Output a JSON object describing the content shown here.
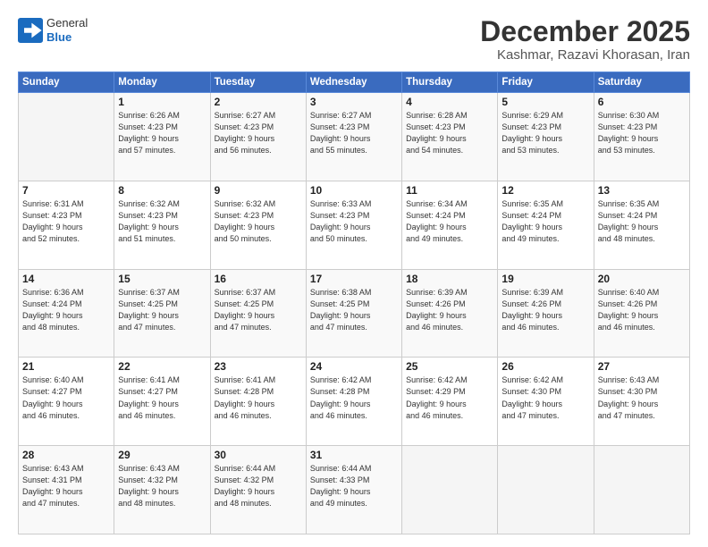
{
  "header": {
    "logo": {
      "general": "General",
      "blue": "Blue"
    },
    "title": "December 2025",
    "location": "Kashmar, Razavi Khorasan, Iran"
  },
  "calendar": {
    "days_of_week": [
      "Sunday",
      "Monday",
      "Tuesday",
      "Wednesday",
      "Thursday",
      "Friday",
      "Saturday"
    ],
    "weeks": [
      [
        {
          "day": "",
          "info": ""
        },
        {
          "day": "1",
          "info": "Sunrise: 6:26 AM\nSunset: 4:23 PM\nDaylight: 9 hours\nand 57 minutes."
        },
        {
          "day": "2",
          "info": "Sunrise: 6:27 AM\nSunset: 4:23 PM\nDaylight: 9 hours\nand 56 minutes."
        },
        {
          "day": "3",
          "info": "Sunrise: 6:27 AM\nSunset: 4:23 PM\nDaylight: 9 hours\nand 55 minutes."
        },
        {
          "day": "4",
          "info": "Sunrise: 6:28 AM\nSunset: 4:23 PM\nDaylight: 9 hours\nand 54 minutes."
        },
        {
          "day": "5",
          "info": "Sunrise: 6:29 AM\nSunset: 4:23 PM\nDaylight: 9 hours\nand 53 minutes."
        },
        {
          "day": "6",
          "info": "Sunrise: 6:30 AM\nSunset: 4:23 PM\nDaylight: 9 hours\nand 53 minutes."
        }
      ],
      [
        {
          "day": "7",
          "info": "Sunrise: 6:31 AM\nSunset: 4:23 PM\nDaylight: 9 hours\nand 52 minutes."
        },
        {
          "day": "8",
          "info": "Sunrise: 6:32 AM\nSunset: 4:23 PM\nDaylight: 9 hours\nand 51 minutes."
        },
        {
          "day": "9",
          "info": "Sunrise: 6:32 AM\nSunset: 4:23 PM\nDaylight: 9 hours\nand 50 minutes."
        },
        {
          "day": "10",
          "info": "Sunrise: 6:33 AM\nSunset: 4:23 PM\nDaylight: 9 hours\nand 50 minutes."
        },
        {
          "day": "11",
          "info": "Sunrise: 6:34 AM\nSunset: 4:24 PM\nDaylight: 9 hours\nand 49 minutes."
        },
        {
          "day": "12",
          "info": "Sunrise: 6:35 AM\nSunset: 4:24 PM\nDaylight: 9 hours\nand 49 minutes."
        },
        {
          "day": "13",
          "info": "Sunrise: 6:35 AM\nSunset: 4:24 PM\nDaylight: 9 hours\nand 48 minutes."
        }
      ],
      [
        {
          "day": "14",
          "info": "Sunrise: 6:36 AM\nSunset: 4:24 PM\nDaylight: 9 hours\nand 48 minutes."
        },
        {
          "day": "15",
          "info": "Sunrise: 6:37 AM\nSunset: 4:25 PM\nDaylight: 9 hours\nand 47 minutes."
        },
        {
          "day": "16",
          "info": "Sunrise: 6:37 AM\nSunset: 4:25 PM\nDaylight: 9 hours\nand 47 minutes."
        },
        {
          "day": "17",
          "info": "Sunrise: 6:38 AM\nSunset: 4:25 PM\nDaylight: 9 hours\nand 47 minutes."
        },
        {
          "day": "18",
          "info": "Sunrise: 6:39 AM\nSunset: 4:26 PM\nDaylight: 9 hours\nand 46 minutes."
        },
        {
          "day": "19",
          "info": "Sunrise: 6:39 AM\nSunset: 4:26 PM\nDaylight: 9 hours\nand 46 minutes."
        },
        {
          "day": "20",
          "info": "Sunrise: 6:40 AM\nSunset: 4:26 PM\nDaylight: 9 hours\nand 46 minutes."
        }
      ],
      [
        {
          "day": "21",
          "info": "Sunrise: 6:40 AM\nSunset: 4:27 PM\nDaylight: 9 hours\nand 46 minutes."
        },
        {
          "day": "22",
          "info": "Sunrise: 6:41 AM\nSunset: 4:27 PM\nDaylight: 9 hours\nand 46 minutes."
        },
        {
          "day": "23",
          "info": "Sunrise: 6:41 AM\nSunset: 4:28 PM\nDaylight: 9 hours\nand 46 minutes."
        },
        {
          "day": "24",
          "info": "Sunrise: 6:42 AM\nSunset: 4:28 PM\nDaylight: 9 hours\nand 46 minutes."
        },
        {
          "day": "25",
          "info": "Sunrise: 6:42 AM\nSunset: 4:29 PM\nDaylight: 9 hours\nand 46 minutes."
        },
        {
          "day": "26",
          "info": "Sunrise: 6:42 AM\nSunset: 4:30 PM\nDaylight: 9 hours\nand 47 minutes."
        },
        {
          "day": "27",
          "info": "Sunrise: 6:43 AM\nSunset: 4:30 PM\nDaylight: 9 hours\nand 47 minutes."
        }
      ],
      [
        {
          "day": "28",
          "info": "Sunrise: 6:43 AM\nSunset: 4:31 PM\nDaylight: 9 hours\nand 47 minutes."
        },
        {
          "day": "29",
          "info": "Sunrise: 6:43 AM\nSunset: 4:32 PM\nDaylight: 9 hours\nand 48 minutes."
        },
        {
          "day": "30",
          "info": "Sunrise: 6:44 AM\nSunset: 4:32 PM\nDaylight: 9 hours\nand 48 minutes."
        },
        {
          "day": "31",
          "info": "Sunrise: 6:44 AM\nSunset: 4:33 PM\nDaylight: 9 hours\nand 49 minutes."
        },
        {
          "day": "",
          "info": ""
        },
        {
          "day": "",
          "info": ""
        },
        {
          "day": "",
          "info": ""
        }
      ]
    ]
  }
}
